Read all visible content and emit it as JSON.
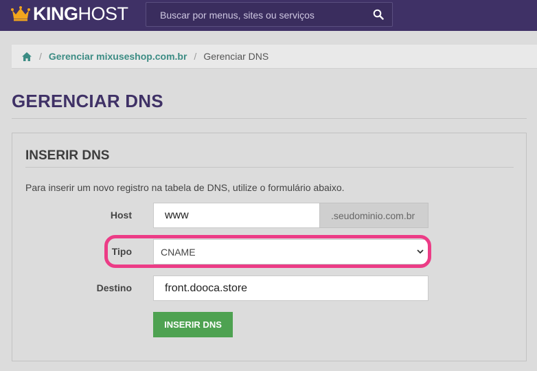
{
  "header": {
    "logo_text_bold": "KING",
    "logo_text_light": "HOST",
    "search": {
      "placeholder": "Buscar por menus, sites ou serviços",
      "icon": "search-icon"
    },
    "colors": {
      "background": "#3f3166",
      "crown": "#f2a51d"
    }
  },
  "breadcrumb": {
    "home_icon": "home-icon",
    "separator": "/",
    "items": [
      {
        "label": "Gerenciar mixuseshop.com.br",
        "link": true
      },
      {
        "label": "Gerenciar DNS",
        "link": false
      }
    ]
  },
  "page": {
    "title": "GERENCIAR DNS"
  },
  "form": {
    "title": "INSERIR DNS",
    "description": "Para inserir um novo registro na tabela de DNS, utilize o formulário abaixo.",
    "host": {
      "label": "Host",
      "value": "www",
      "suffix": ".seudominio.com.br"
    },
    "tipo": {
      "label": "Tipo",
      "selected": "CNAME"
    },
    "destino": {
      "label": "Destino",
      "value": "front.dooca.store"
    },
    "submit_label": "INSERIR DNS",
    "colors": {
      "submit": "#4ea251",
      "highlight": "#ec3c86",
      "link": "#3c8c84"
    }
  }
}
